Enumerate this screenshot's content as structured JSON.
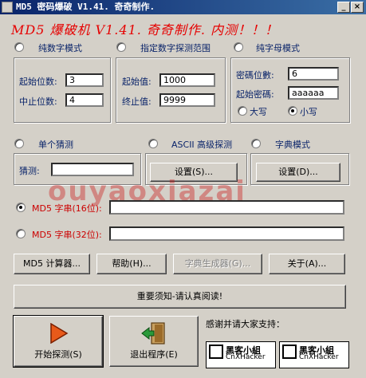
{
  "window": {
    "title": "MD5 密码爆破 V1.41. 奇奇制作.",
    "minimize_glyph": "_",
    "close_glyph": "×"
  },
  "banner": "MD5 爆破机 V1.41. 奇奇制作.    内测！！！",
  "mode_numeric": {
    "label": "纯数字模式",
    "start_digits_label": "起始位数:",
    "start_digits_value": "3",
    "end_digits_label": "中止位数:",
    "end_digits_value": "4"
  },
  "mode_range": {
    "label": "指定数字探测范围",
    "start_label": "起始值:",
    "start_value": "1000",
    "end_label": "终止值:",
    "end_value": "9999"
  },
  "mode_letters": {
    "label": "纯字母模式",
    "digits_label": "密碼位數:",
    "digits_value": "6",
    "start_pwd_label": "起始密碼:",
    "start_pwd_value": "aaaaaa",
    "upper_label": "大写",
    "lower_label": "小写"
  },
  "mode_single": {
    "label": "单个猜测",
    "guess_label": "猜测:",
    "guess_value": ""
  },
  "mode_ascii": {
    "label": "ASCII 高级探测",
    "settings_label": "设置(S)..."
  },
  "mode_dict": {
    "label": "字典模式",
    "settings_label": "设置(D)..."
  },
  "md5_16": {
    "label": "MD5 字串(16位):",
    "value": ""
  },
  "md5_32": {
    "label": "MD5 字串(32位):",
    "value": ""
  },
  "buttons": {
    "calculator": "MD5 计算器...",
    "help": "帮助(H)...",
    "dict_gen": "字典生成器(G)...",
    "about": "关于(A)...",
    "notice": "重要须知-请认真阅读!",
    "start": "开始探测(S)",
    "exit": "退出程序(E)"
  },
  "support_text": "感谢并请大家支持：",
  "logos": [
    {
      "line1": "黑客小組",
      "line2": "CnXHacker"
    },
    {
      "line1": "黑客小組",
      "line2": "CnXHacker"
    }
  ],
  "watermark": "ouyaoxiazai",
  "colors": {
    "banner_red": "#e60000",
    "label_blue": "#0a246a",
    "title_bar": "#0a246a"
  }
}
